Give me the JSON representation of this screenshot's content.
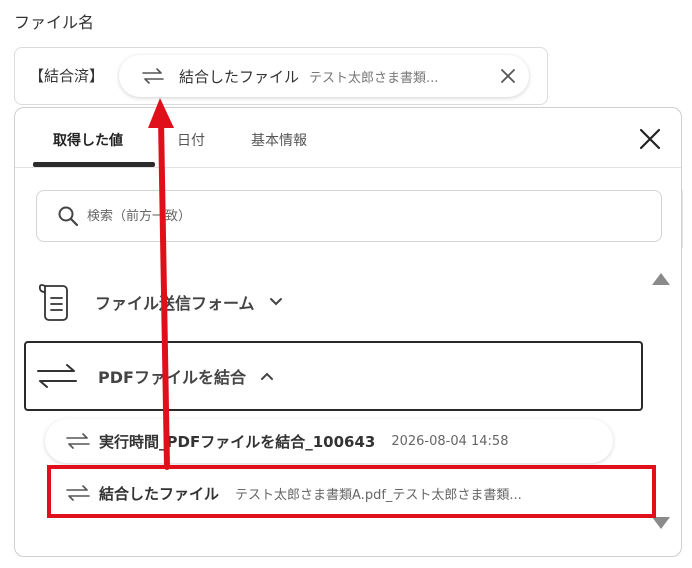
{
  "field": {
    "label": "ファイル名"
  },
  "value_box": {
    "prefix": "【結合済】",
    "chip": {
      "label": "結合したファイル",
      "value": "テスト太郎さま書類..."
    }
  },
  "panel": {
    "tabs": [
      {
        "label": "取得した値",
        "active": true
      },
      {
        "label": "日付",
        "active": false
      },
      {
        "label": "基本情報",
        "active": false
      }
    ],
    "search": {
      "placeholder": "検索（前方一致）"
    },
    "sections": [
      {
        "label": "ファイル送信フォーム",
        "expanded": false
      },
      {
        "label": "PDFファイルを結合",
        "expanded": true
      }
    ],
    "items": [
      {
        "label": "実行時間_PDFファイルを結合_100643",
        "value": "2026-08-04 14:58"
      },
      {
        "label": "結合したファイル",
        "value": "テスト太郎さま書類A.pdf_テスト太郎さま書類..."
      }
    ]
  },
  "colors": {
    "annotation_red": "#e0101a",
    "text": "#333333",
    "border": "#cfcfcf"
  }
}
